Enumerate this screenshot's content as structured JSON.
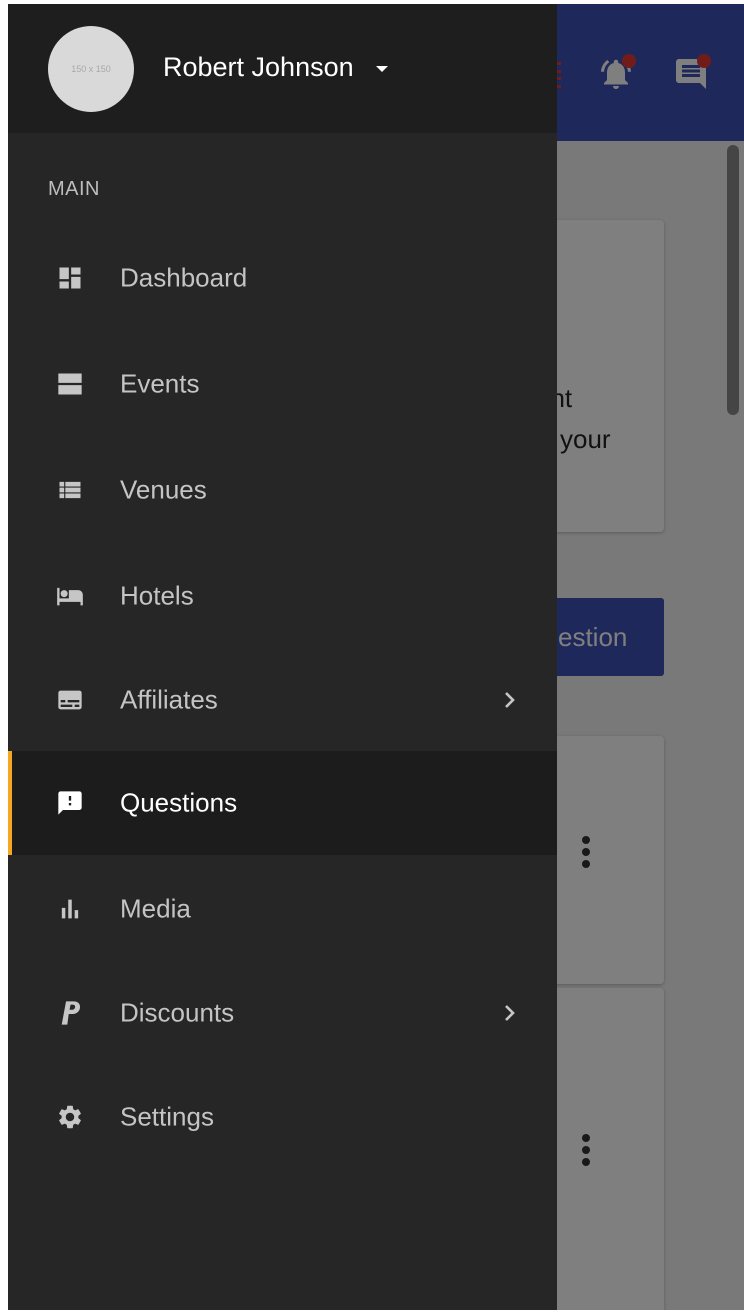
{
  "user": {
    "name": "Robert Johnson",
    "avatar_text": "150 x 150"
  },
  "sidebar": {
    "section_label": "MAIN",
    "items": [
      {
        "label": "Dashboard",
        "icon": "dashboard-icon"
      },
      {
        "label": "Events",
        "icon": "events-icon"
      },
      {
        "label": "Venues",
        "icon": "venues-list-icon"
      },
      {
        "label": "Hotels",
        "icon": "hotel-bed-icon"
      },
      {
        "label": "Affiliates",
        "icon": "affiliates-icon",
        "has_submenu": true
      },
      {
        "label": "Questions",
        "icon": "question-feedback-icon",
        "active": true
      },
      {
        "label": "Media",
        "icon": "bar-chart-icon"
      },
      {
        "label": "Discounts",
        "icon": "discount-p-icon",
        "has_submenu": true
      },
      {
        "label": "Settings",
        "icon": "gear-icon"
      }
    ]
  },
  "background": {
    "card_text_line1": "ent",
    "card_text_line2": "your",
    "button_label": "estion"
  },
  "colors": {
    "topbar": "#3f51b5",
    "drawer": "#262626",
    "drawer_header": "#1e1e1e",
    "active_indicator": "#f5a623",
    "notification_dot": "#e53935"
  }
}
